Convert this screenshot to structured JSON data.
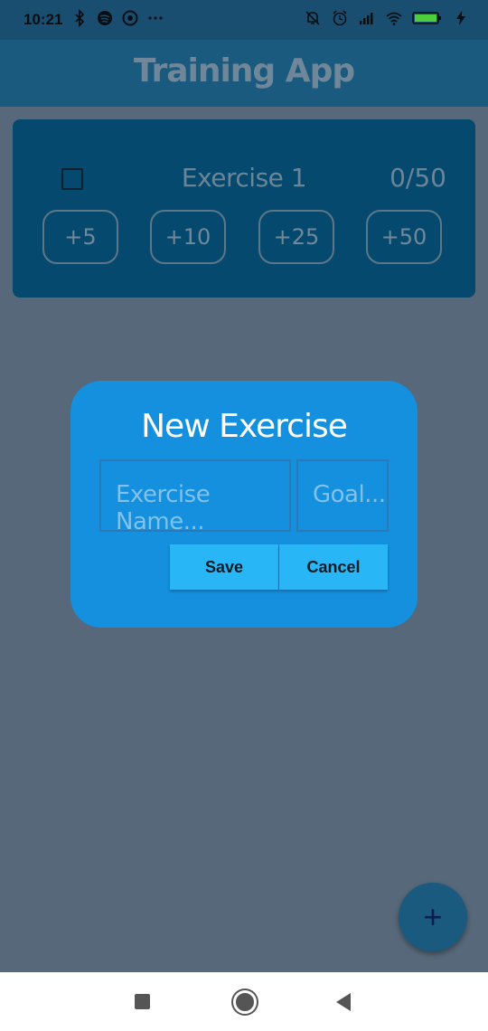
{
  "status_bar": {
    "time": "10:21",
    "left_icons": [
      "bluetooth-icon",
      "spotify-icon",
      "app-icon",
      "more-dots-icon"
    ],
    "right_icons": [
      "mute-icon",
      "alarm-icon",
      "signal-icon",
      "wifi-icon",
      "battery-icon",
      "charging-icon"
    ]
  },
  "app_bar": {
    "title": "Training App"
  },
  "exercise_card": {
    "name": "Exercise 1",
    "progress": "0/50",
    "increment_buttons": [
      "+5",
      "+10",
      "+25",
      "+50"
    ]
  },
  "dialog": {
    "title": "New Exercise",
    "name_placeholder": "Exercise Name...",
    "goal_placeholder": "Goal...",
    "save_label": "Save",
    "cancel_label": "Cancel"
  },
  "fab": {
    "label": "+"
  },
  "colors": {
    "app_bar": "#1a5a7f",
    "card": "#054a6e",
    "dialog": "#1590de",
    "dialog_button": "#29b6f6",
    "scrim_background": "#56687a"
  }
}
